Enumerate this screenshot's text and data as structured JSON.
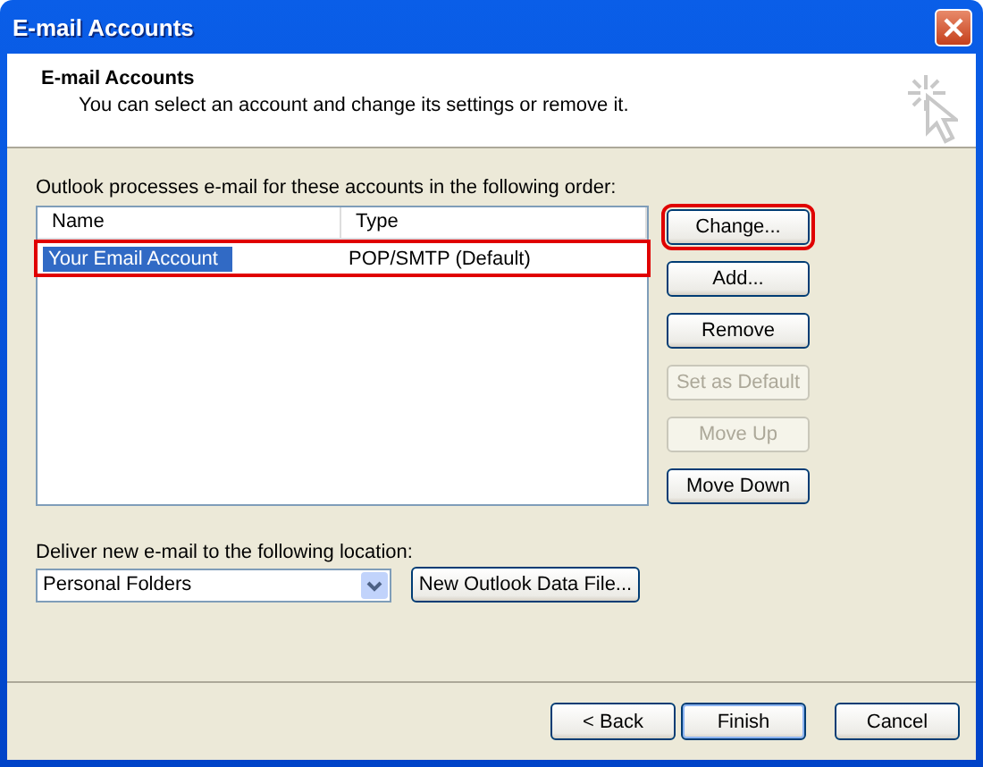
{
  "window": {
    "title": "E-mail Accounts"
  },
  "header": {
    "title": "E-mail Accounts",
    "description": "You can select an account and change its settings or remove it."
  },
  "accounts": {
    "label": "Outlook processes e-mail for these accounts in the following order:",
    "columns": [
      "Name",
      "Type"
    ],
    "rows": [
      {
        "name": "Your Email Account",
        "type": "POP/SMTP (Default)",
        "selected": true,
        "highlighted": true
      }
    ]
  },
  "account_buttons": [
    {
      "label": "Change...",
      "disabled": false,
      "highlighted": true
    },
    {
      "label": "Add...",
      "disabled": false,
      "highlighted": false
    },
    {
      "label": "Remove",
      "disabled": false,
      "highlighted": false
    },
    {
      "label": "Set as Default",
      "disabled": true,
      "highlighted": false
    },
    {
      "label": "Move Up",
      "disabled": true,
      "highlighted": false
    },
    {
      "label": "Move Down",
      "disabled": false,
      "highlighted": false
    }
  ],
  "delivery": {
    "label": "Deliver new e-mail to the following location:",
    "location": "Personal Folders",
    "new_file_button": "New Outlook Data File..."
  },
  "footer_buttons": [
    {
      "label": "< Back",
      "default": false
    },
    {
      "label": "Finish",
      "default": true
    },
    {
      "label": "Cancel",
      "default": false
    }
  ]
}
